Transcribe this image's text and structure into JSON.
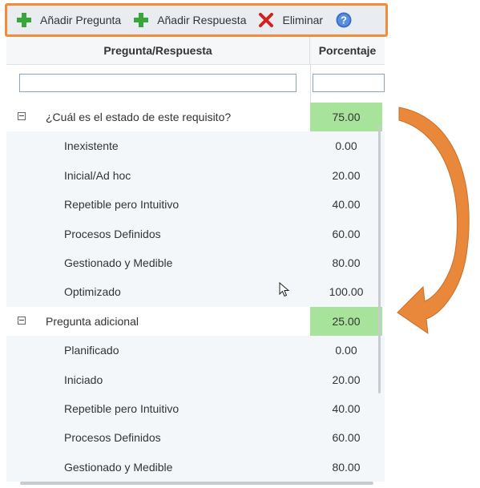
{
  "toolbar": {
    "add_question": "Añadir Pregunta",
    "add_answer": "Añadir Respuesta",
    "delete": "Eliminar"
  },
  "icons": {
    "add": "plus-icon",
    "delete": "x-icon",
    "help": "help-icon",
    "expand": "collapse-icon"
  },
  "colors": {
    "toolbar_border": "#f28c38",
    "question_pct_bg": "#a7e39b",
    "add_icon": "#3aa63a",
    "delete_icon": "#d62020",
    "help_icon": "#3a6fc4",
    "arrow": "#e9873a"
  },
  "grid": {
    "col_question": "Pregunta/Respuesta",
    "col_percent": "Porcentaje",
    "rows": [
      {
        "type": "q",
        "text": "¿Cuál es el estado de este requisito?",
        "pct": "75.00"
      },
      {
        "type": "a",
        "text": "Inexistente",
        "pct": "0.00"
      },
      {
        "type": "a",
        "text": "Inicial/Ad hoc",
        "pct": "20.00"
      },
      {
        "type": "a",
        "text": "Repetible pero Intuitivo",
        "pct": "40.00"
      },
      {
        "type": "a",
        "text": "Procesos Definidos",
        "pct": "60.00"
      },
      {
        "type": "a",
        "text": "Gestionado y Medible",
        "pct": "80.00"
      },
      {
        "type": "a",
        "text": "Optimizado",
        "pct": "100.00"
      },
      {
        "type": "q",
        "text": "Pregunta adicional",
        "pct": "25.00"
      },
      {
        "type": "a",
        "text": "Planificado",
        "pct": "0.00"
      },
      {
        "type": "a",
        "text": "Iniciado",
        "pct": "20.00"
      },
      {
        "type": "a",
        "text": "Repetible pero Intuitivo",
        "pct": "40.00"
      },
      {
        "type": "a",
        "text": "Procesos Definidos",
        "pct": "60.00"
      },
      {
        "type": "a",
        "text": "Gestionado y Medible",
        "pct": "80.00"
      }
    ]
  }
}
